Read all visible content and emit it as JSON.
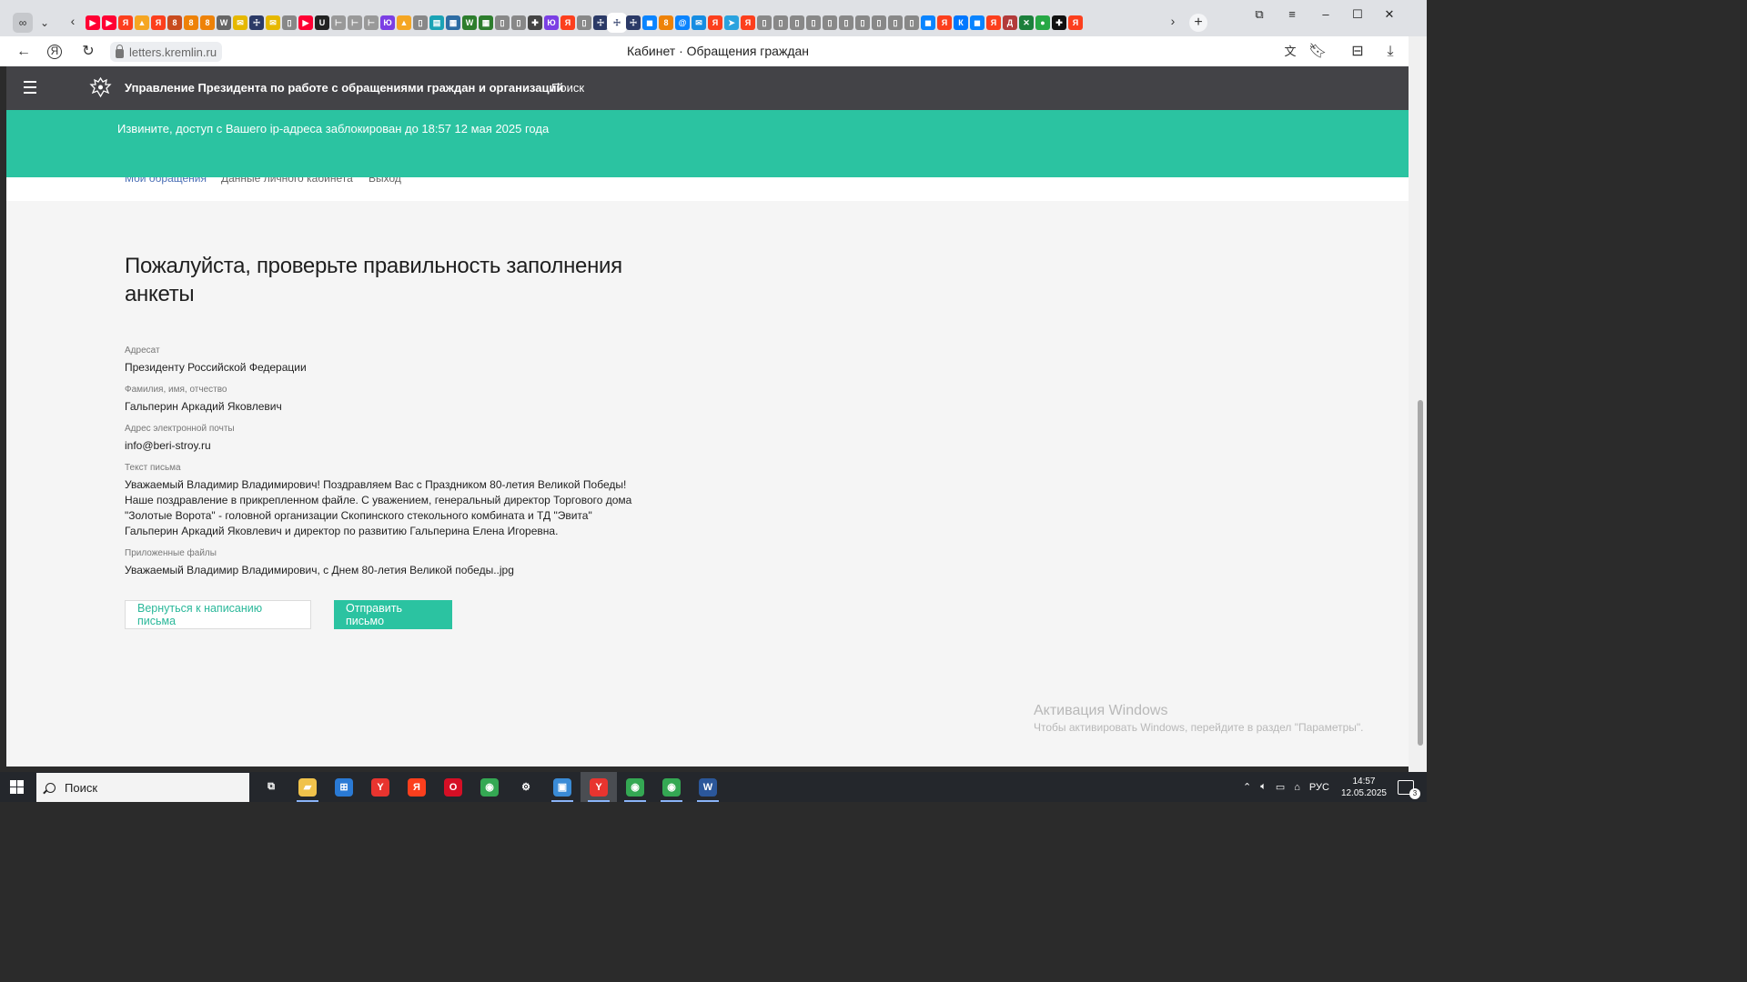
{
  "browser": {
    "url": "letters.kremlin.ru",
    "page_title": "Кабинет · Обращения граждан",
    "favicons": [
      {
        "name": "youtube-tab-icon",
        "color": "#ff0033",
        "glyph": "▶"
      },
      {
        "name": "youtube-tab-icon",
        "color": "#ff0033",
        "glyph": "▶"
      },
      {
        "name": "yandex-tab-icon",
        "color": "#fc3f1d",
        "glyph": "Я"
      },
      {
        "name": "zen-tab-icon",
        "color": "#f5a623",
        "glyph": "▲"
      },
      {
        "name": "yandex-tab-icon",
        "color": "#fc3f1d",
        "glyph": "Я"
      },
      {
        "name": "ok-tab-icon",
        "color": "#c84b1e",
        "glyph": "8"
      },
      {
        "name": "ok-tab-icon",
        "color": "#ee8208",
        "glyph": "8"
      },
      {
        "name": "ok-tab-icon",
        "color": "#ee8208",
        "glyph": "8"
      },
      {
        "name": "wikipedia-tab-icon",
        "color": "#666666",
        "glyph": "W"
      },
      {
        "name": "mail-tab-icon",
        "color": "#e6b800",
        "glyph": "✉"
      },
      {
        "name": "kremlin-tab-icon",
        "color": "#2b3a67",
        "glyph": "☩"
      },
      {
        "name": "mail-tab-icon",
        "color": "#e6b800",
        "glyph": "✉"
      },
      {
        "name": "page-tab-icon",
        "color": "#888888",
        "glyph": "▯"
      },
      {
        "name": "youtube-tab-icon",
        "color": "#ff0033",
        "glyph": "▶"
      },
      {
        "name": "u-tab-icon",
        "color": "#222222",
        "glyph": "U"
      },
      {
        "name": "bookmark-tab-icon",
        "color": "#999999",
        "glyph": "⊢"
      },
      {
        "name": "bookmark-tab-icon",
        "color": "#999999",
        "glyph": "⊢"
      },
      {
        "name": "bookmark-tab-icon",
        "color": "#999999",
        "glyph": "⊢"
      },
      {
        "name": "yo-tab-icon",
        "color": "#7b3fe4",
        "glyph": "Ю"
      },
      {
        "name": "zen-tab-icon",
        "color": "#f5a623",
        "glyph": "▲"
      },
      {
        "name": "page-tab-icon",
        "color": "#888888",
        "glyph": "▯"
      },
      {
        "name": "gosuslugi-tab-icon",
        "color": "#1aa3b5",
        "glyph": "▤"
      },
      {
        "name": "grid-tab-icon",
        "color": "#2e6da4",
        "glyph": "▦"
      },
      {
        "name": "w-tab-icon",
        "color": "#2d7d2d",
        "glyph": "W"
      },
      {
        "name": "grid-tab-icon",
        "color": "#2d7d2d",
        "glyph": "▦"
      },
      {
        "name": "page-tab-icon",
        "color": "#888888",
        "glyph": "▯"
      },
      {
        "name": "page-tab-icon",
        "color": "#888888",
        "glyph": "▯"
      },
      {
        "name": "extension-tab-icon",
        "color": "#444444",
        "glyph": "✚"
      },
      {
        "name": "yo-tab-icon",
        "color": "#7b3fe4",
        "glyph": "Ю"
      },
      {
        "name": "yandex-tab-icon",
        "color": "#fc3f1d",
        "glyph": "Я"
      },
      {
        "name": "page-tab-icon",
        "color": "#888888",
        "glyph": "▯"
      },
      {
        "name": "kremlin-tab-icon",
        "color": "#2b3a67",
        "glyph": "☩"
      },
      {
        "name": "kremlin-tab-icon",
        "color": "#2b3a67",
        "glyph": "☩",
        "active": true
      },
      {
        "name": "kremlin-tab-icon",
        "color": "#2b3a67",
        "glyph": "☩"
      },
      {
        "name": "messenger-tab-icon",
        "color": "#0a84ff",
        "glyph": "◼"
      },
      {
        "name": "ok-tab-icon",
        "color": "#ee8208",
        "glyph": "8"
      },
      {
        "name": "at-tab-icon",
        "color": "#0a84ff",
        "glyph": "@"
      },
      {
        "name": "mail-tab-icon",
        "color": "#168de2",
        "glyph": "✉"
      },
      {
        "name": "yandex-tab-icon",
        "color": "#fc3f1d",
        "glyph": "Я"
      },
      {
        "name": "telegram-tab-icon",
        "color": "#2aa3df",
        "glyph": "➤"
      },
      {
        "name": "yandex-tab-icon",
        "color": "#fc3f1d",
        "glyph": "Я"
      },
      {
        "name": "page-tab-icon",
        "color": "#888888",
        "glyph": "▯"
      },
      {
        "name": "page-tab-icon",
        "color": "#888888",
        "glyph": "▯"
      },
      {
        "name": "page-tab-icon",
        "color": "#888888",
        "glyph": "▯"
      },
      {
        "name": "page-tab-icon",
        "color": "#888888",
        "glyph": "▯"
      },
      {
        "name": "page-tab-icon",
        "color": "#888888",
        "glyph": "▯"
      },
      {
        "name": "page-tab-icon",
        "color": "#888888",
        "glyph": "▯"
      },
      {
        "name": "page-tab-icon",
        "color": "#888888",
        "glyph": "▯"
      },
      {
        "name": "page-tab-icon",
        "color": "#888888",
        "glyph": "▯"
      },
      {
        "name": "page-tab-icon",
        "color": "#888888",
        "glyph": "▯"
      },
      {
        "name": "page-tab-icon",
        "color": "#888888",
        "glyph": "▯"
      },
      {
        "name": "messenger-tab-icon",
        "color": "#0a84ff",
        "glyph": "◼"
      },
      {
        "name": "yandex-tab-icon",
        "color": "#fc3f1d",
        "glyph": "Я"
      },
      {
        "name": "vk-tab-icon",
        "color": "#0077ff",
        "glyph": "К"
      },
      {
        "name": "messenger-tab-icon",
        "color": "#0a84ff",
        "glyph": "◼"
      },
      {
        "name": "yandex-tab-icon",
        "color": "#fc3f1d",
        "glyph": "Я"
      },
      {
        "name": "delo-tab-icon",
        "color": "#b23a3a",
        "glyph": "Д"
      },
      {
        "name": "x-tab-icon",
        "color": "#1b7f3b",
        "glyph": "✕"
      },
      {
        "name": "circle-tab-icon",
        "color": "#27a845",
        "glyph": "●"
      },
      {
        "name": "plus-tab-icon",
        "color": "#111111",
        "glyph": "✚"
      },
      {
        "name": "yandex-tab-icon",
        "color": "#fc3f1d",
        "glyph": "Я"
      }
    ]
  },
  "site": {
    "name": "Управление Президента по работе с обращениями граждан и организаций",
    "search_label": "Поиск",
    "alert": "Извините, доступ с Вашего ip-адреса заблокирован до 18:57 12 мая 2025 года",
    "subnav": [
      "Мои обращения",
      "Данные личного кабинета",
      "Выход"
    ]
  },
  "form": {
    "heading_line1": "Пожалуйста, проверьте правильность заполнения",
    "heading_line2": "анкеты",
    "fields": [
      {
        "label": "Адресат",
        "value": "Президенту Российской Федерации"
      },
      {
        "label": "Фамилия, имя, отчество",
        "value": "Гальперин Аркадий Яковлевич"
      },
      {
        "label": "Адрес электронной почты",
        "value": "info@beri-stroy.ru"
      }
    ],
    "letter_label": "Текст письма",
    "letter_lines": [
      "Уважаемый Владимир Владимирович! Поздравляем Вас с Праздником 80-летия Великой Победы!",
      "Наше поздравление в прикрепленном файле. С уважением, генеральный директор Торгового дома",
      "\"Золотые Ворота\" - головной организации Скопинского стекольного комбината и ТД \"Эвита\"",
      "Гальперин Аркадий Яковлевич и директор по развитию Гальперина Елена Игоревна."
    ],
    "files_label": "Приложенные файлы",
    "file_name": "Уважаемый Владимир Владимирович, с Днем 80-летия Великой победы..jpg",
    "back_button": "Вернуться к написанию письма",
    "send_button": "Отправить письмо"
  },
  "watermark": {
    "title": "Активация Windows",
    "subtitle": "Чтобы активировать Windows, перейдите в раздел \"Параметры\"."
  },
  "taskbar": {
    "search_placeholder": "Поиск",
    "apps": [
      {
        "name": "task-view-icon",
        "glyph": "⧉",
        "color": "transparent"
      },
      {
        "name": "file-explorer-icon",
        "glyph": "▰",
        "color": "#f0c24b",
        "running": true
      },
      {
        "name": "store-icon",
        "glyph": "⊞",
        "color": "#2a7ad5"
      },
      {
        "name": "yandex-browser-icon",
        "glyph": "Y",
        "color": "#e8342f"
      },
      {
        "name": "yandex-icon",
        "glyph": "Я",
        "color": "#fc3f1d"
      },
      {
        "name": "opera-icon",
        "glyph": "O",
        "color": "#d50f25"
      },
      {
        "name": "chrome-icon",
        "glyph": "◉",
        "color": "#34a853"
      },
      {
        "name": "settings-icon",
        "glyph": "⚙",
        "color": "transparent"
      },
      {
        "name": "remote-desktop-icon",
        "glyph": "▣",
        "color": "#3a8bd6",
        "running": true
      },
      {
        "name": "yandex-browser-icon",
        "glyph": "Y",
        "color": "#e8342f",
        "active": true,
        "running": true
      },
      {
        "name": "chrome-profile-icon",
        "glyph": "◉",
        "color": "#34a853",
        "running": true
      },
      {
        "name": "chrome-profile-icon",
        "glyph": "◉",
        "color": "#34a853",
        "running": true
      },
      {
        "name": "word-icon",
        "glyph": "W",
        "color": "#2b579a",
        "running": true
      }
    ],
    "lang": "РУС",
    "time": "14:57",
    "date": "12.05.2025"
  }
}
